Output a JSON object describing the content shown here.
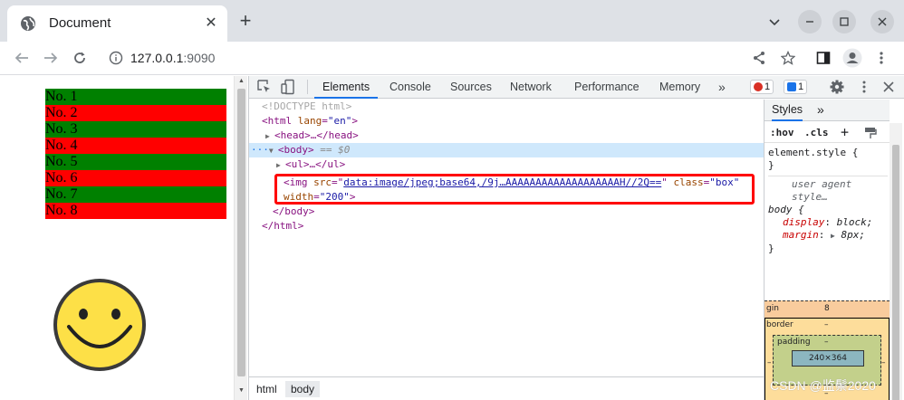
{
  "browser": {
    "tab_title": "Document",
    "tab_close": "✕",
    "new_tab": "+",
    "url_host": "127.0.0.1",
    "url_port": ":9090"
  },
  "page": {
    "list_items": [
      "No. 1",
      "No. 2",
      "No. 3",
      "No. 4",
      "No. 5",
      "No. 6",
      "No. 7",
      "No. 8"
    ],
    "colors": {
      "even": "#008000",
      "odd": "#ff0000"
    }
  },
  "devtools": {
    "tabs": [
      "Elements",
      "Console",
      "Sources",
      "Network",
      "Performance",
      "Memory"
    ],
    "more": "»",
    "errors": "1",
    "messages": "1",
    "dom": {
      "doctype": "<!DOCTYPE html>",
      "html_open": "<html",
      "html_lang_attr": "lang",
      "html_lang_val": "\"en\"",
      "head": "<head>…</head>",
      "body_open": "<body>",
      "body_eq": "== $0",
      "ul": "<ul>…</ul>",
      "img_open": "<img",
      "img_src_attr": "src",
      "img_src_val": "data:image/jpeg;base64,/9j…AAAAAAAAAAAAAAAAAAAH//2Q==",
      "img_class_attr": "class",
      "img_class_val": "\"box\"",
      "img_width_attr": "width",
      "img_width_val": "\"200\"",
      "body_close": "</body>",
      "html_close": "</html>",
      "ellipsis": "···"
    },
    "crumbs": [
      "html",
      "body"
    ],
    "styles": {
      "tab": "Styles",
      "more": "»",
      "hov": ":hov",
      "cls": ".cls",
      "plus": "+",
      "element_style": "element.style {",
      "close_brace": "}",
      "ua_label": "user agent style…",
      "body_selector": "body {",
      "display_prop": "display",
      "display_val": "block;",
      "margin_prop": "margin",
      "margin_val": "8px;",
      "bm_margin_label": "gin",
      "bm_margin_val": "8",
      "bm_border_label": "border",
      "bm_border_val": "–",
      "bm_padding_label": "padding",
      "bm_padding_val": "–",
      "bm_content": "240×364",
      "bm_dash": "–"
    }
  },
  "watermark": "CSDN @监鬃2020"
}
